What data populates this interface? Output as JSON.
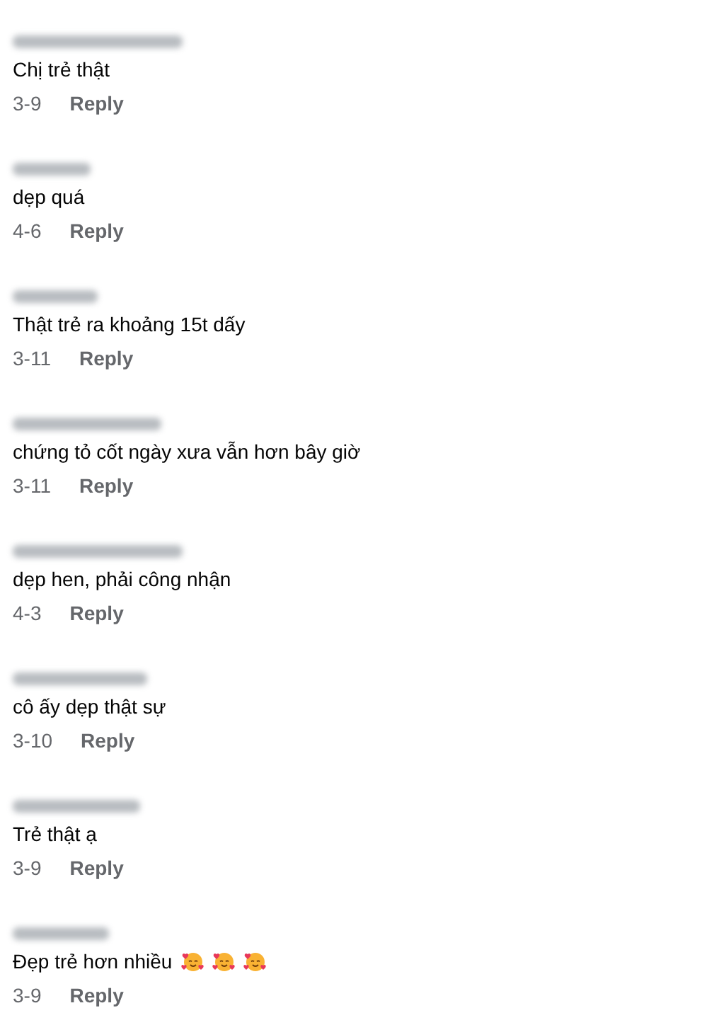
{
  "comments": [
    {
      "text": "Chị trẻ thật",
      "date": "3-9",
      "reply": "Reply"
    },
    {
      "text": "dẹp quá",
      "date": "4-6",
      "reply": "Reply"
    },
    {
      "text": "Thật trẻ ra khoảng 15t dấy",
      "date": "3-11",
      "reply": "Reply"
    },
    {
      "text": "chứng tỏ cốt ngày xưa vẫn hơn bây giờ",
      "date": "3-11",
      "reply": "Reply"
    },
    {
      "text": "dẹp hen, phải công nhận",
      "date": "4-3",
      "reply": "Reply"
    },
    {
      "text": "cô ấy dẹp thật sự",
      "date": "3-10",
      "reply": "Reply"
    },
    {
      "text": "Trẻ thật ạ",
      "date": "3-9",
      "reply": "Reply"
    },
    {
      "text": "Đẹp trẻ hơn nhiều",
      "date": "3-9",
      "reply": "Reply",
      "emojis": [
        {
          "kind": "smiling-hearts"
        },
        {
          "kind": "smiling-hearts"
        },
        {
          "kind": "smiling-hearts"
        }
      ]
    }
  ]
}
